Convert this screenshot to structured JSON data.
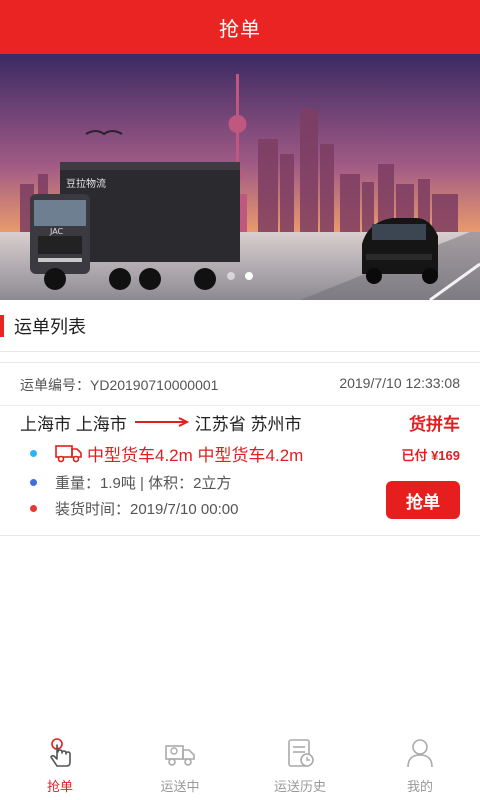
{
  "header": {
    "title": "抢单"
  },
  "banner": {
    "truck_brand_text": "豆拉物流",
    "truck_logo_text": "JAC",
    "slides_total": 2,
    "active_slide": 2
  },
  "section": {
    "title": "运单列表"
  },
  "orders": [
    {
      "number_label": "运单编号：",
      "number": "YD20190710000001",
      "datetime": "2019/7/10 12:33:08",
      "origin": "上海市 上海市",
      "destination": "江苏省 苏州市",
      "type_tag": "货拼车",
      "vehicle_text": "中型货车4.2m 中型货车4.2m",
      "paid_text": "已付 ¥169",
      "weight_text": "重量：1.9吨 | 体积：2立方",
      "load_time_text": "装货时间：2019/7/10 00:00",
      "grab_label": "抢单",
      "bullet_colors": {
        "vehicle": "#29b6f6",
        "weight": "#3f6fd8",
        "time": "#e53935"
      }
    }
  ],
  "tabbar": {
    "items": [
      {
        "label": "抢单",
        "icon": "hand-tap-icon",
        "active": true
      },
      {
        "label": "运送中",
        "icon": "delivery-truck-icon",
        "active": false
      },
      {
        "label": "运送历史",
        "icon": "history-document-icon",
        "active": false
      },
      {
        "label": "我的",
        "icon": "person-icon",
        "active": false
      }
    ]
  },
  "colors": {
    "brand_red": "#ea2323",
    "inactive_gray": "#999999"
  }
}
